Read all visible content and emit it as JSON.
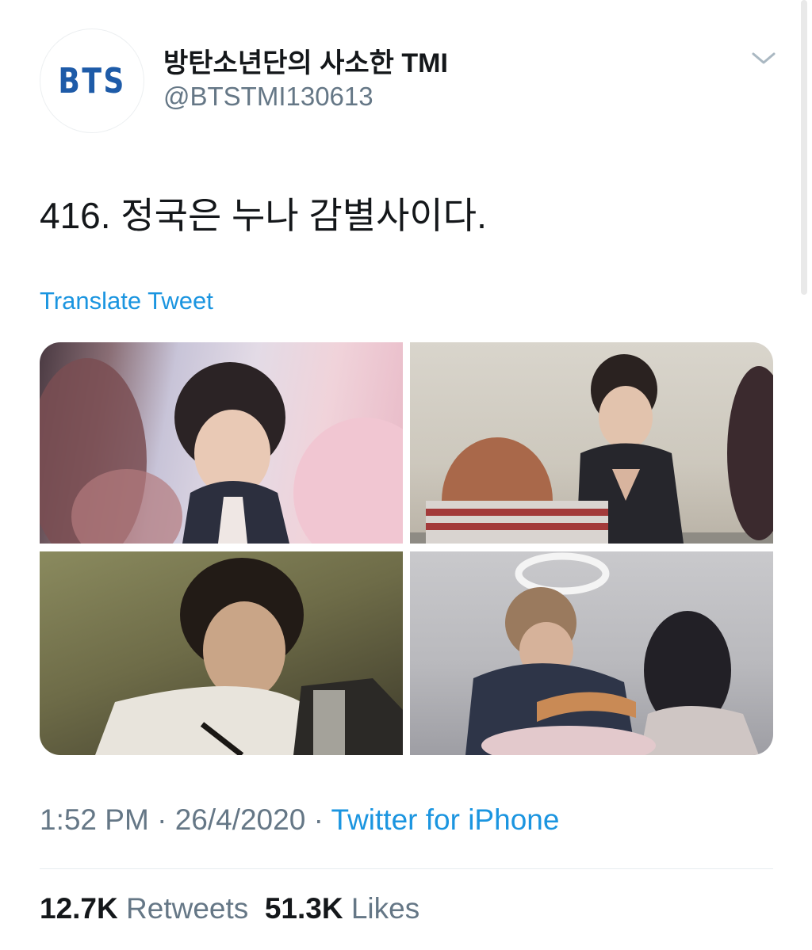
{
  "account": {
    "avatar_text": "BTS",
    "display_name": "방탄소년단의 사소한 TMI",
    "handle": "@BTSTMI130613",
    "brand_color": "#1e5ba8"
  },
  "tweet": {
    "text": "416. 정국은 누나 감별사이다.",
    "translate_label": "Translate Tweet",
    "media_count": 4
  },
  "meta": {
    "time": "1:52 PM",
    "separator": " · ",
    "date": "26/4/2020",
    "source": "Twitter for iPhone"
  },
  "stats": {
    "retweets_count": "12.7K",
    "retweets_label": "Retweets",
    "likes_count": "51.3K",
    "likes_label": "Likes"
  },
  "colors": {
    "text": "#14171a",
    "secondary": "#657786",
    "link": "#1b95e0",
    "divider": "#e6ecf0"
  },
  "icons": {
    "menu": "chevron-down-icon"
  }
}
